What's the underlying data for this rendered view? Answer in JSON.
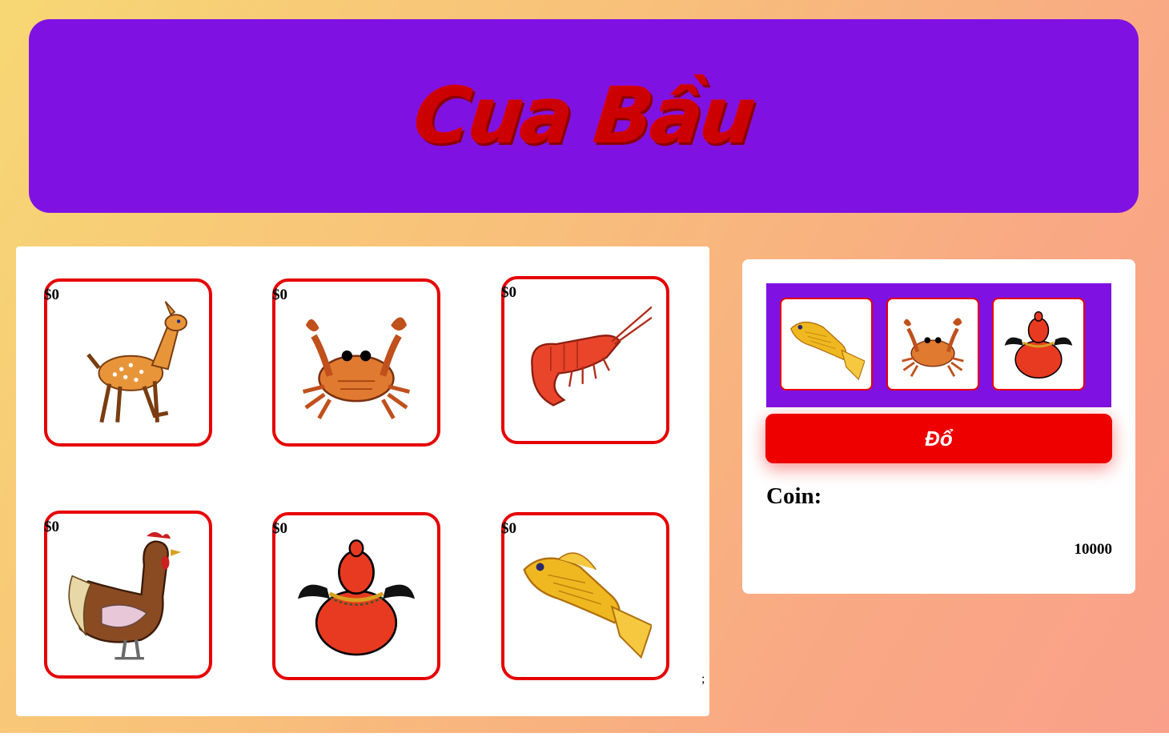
{
  "header": {
    "title": "Cua Bầu"
  },
  "board": {
    "cells": [
      {
        "animal": "deer-icon",
        "bet": "$0"
      },
      {
        "animal": "crab-icon",
        "bet": "$0"
      },
      {
        "animal": "shrimp-icon",
        "bet": "$0"
      },
      {
        "animal": "rooster-icon",
        "bet": "$0"
      },
      {
        "animal": "gourd-icon",
        "bet": "$0"
      },
      {
        "animal": "fish-icon",
        "bet": "$0"
      }
    ],
    "stray_text": ";"
  },
  "panel": {
    "dice": [
      "fish-icon",
      "crab-icon",
      "gourd-icon"
    ],
    "roll_label": "Đổ",
    "coin_label": "Coin:",
    "coin_value": "10000"
  },
  "colors": {
    "header_bg": "#7f12e2",
    "title": "#cc0000",
    "border": "#e60000",
    "button": "#ee0000"
  }
}
